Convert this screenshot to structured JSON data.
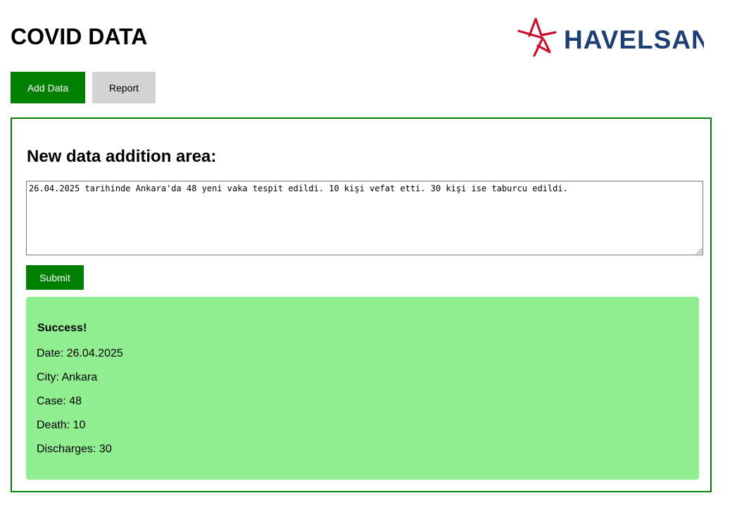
{
  "header": {
    "title": "COVID DATA",
    "logo_text": "HAVELSAN"
  },
  "nav": {
    "add_data_label": "Add Data",
    "report_label": "Report"
  },
  "form": {
    "section_title": "New data addition area:",
    "textarea_value": "26.04.2025 tarihinde Ankara'da 48 yeni vaka tespit edildi. 10 kişi vefat etti. 30 kişi ise taburcu edildi.",
    "submit_label": "Submit"
  },
  "result": {
    "heading": "Success!",
    "lines": [
      "Date: 26.04.2025",
      "City: Ankara",
      "Case: 48",
      "Death: 10",
      "Discharges: 30"
    ]
  },
  "colors": {
    "primary_green": "#008000",
    "success_bg": "#90ee90",
    "neutral_button": "#d3d3d3",
    "logo_blue": "#1d3f73",
    "logo_red": "#c8102e"
  }
}
